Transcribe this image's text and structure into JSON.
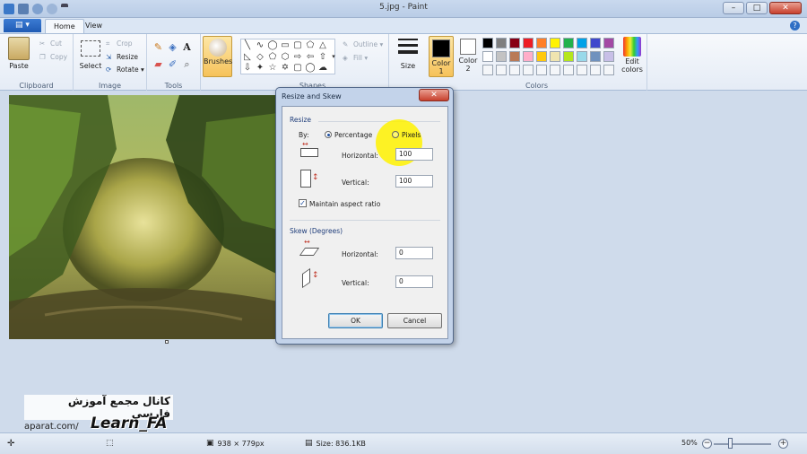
{
  "window": {
    "title": "5.jpg - Paint",
    "controls": {
      "minimize": "–",
      "maximize": "□",
      "close": "✕"
    }
  },
  "tabs": {
    "file": "▤ ▾",
    "home": "Home",
    "view": "View",
    "help": "?"
  },
  "ribbon": {
    "clipboard": {
      "paste": "Paste",
      "cut": "Cut",
      "copy": "Copy",
      "label": "Clipboard"
    },
    "image": {
      "select": "Select",
      "crop": "Crop",
      "resize": "Resize",
      "rotate": "Rotate ▾",
      "label": "Image"
    },
    "tools": {
      "label": "Tools",
      "brushes": "Brushes"
    },
    "shapes": {
      "outline": "Outline ▾",
      "fill": "Fill ▾",
      "label": "Shapes"
    },
    "size": {
      "label": "Size"
    },
    "colors": {
      "color1": "Color 1",
      "color2": "Color 2",
      "edit": "Edit colors",
      "label": "Colors",
      "palette": [
        "#000000",
        "#7f7f7f",
        "#880015",
        "#ed1c24",
        "#ff7f27",
        "#fff200",
        "#22b14c",
        "#00a2e8",
        "#3f48cc",
        "#a349a4",
        "#ffffff",
        "#c3c3c3",
        "#b97a57",
        "#ffaec9",
        "#ffc90e",
        "#efe4b0",
        "#b5e61d",
        "#99d9ea",
        "#7092be",
        "#c8bfe7"
      ]
    }
  },
  "dialog": {
    "title": "Resize and Skew",
    "close": "✕",
    "resize_section": "Resize",
    "by_label": "By:",
    "percentage": "Percentage",
    "pixels": "Pixels",
    "horizontal_label": "Horizontal:",
    "horizontal_value": "100",
    "vertical_label": "Vertical:",
    "vertical_value": "100",
    "maintain_label": "Maintain aspect ratio",
    "maintain_checked": true,
    "skew_section": "Skew (Degrees)",
    "skew_horizontal_label": "Horizontal:",
    "skew_horizontal_value": "0",
    "skew_vertical_label": "Vertical:",
    "skew_vertical_value": "0",
    "ok": "OK",
    "cancel": "Cancel"
  },
  "watermark": {
    "persian": "کانال مجمع آموزش فارسی",
    "site": "aparat.com/",
    "brand": "Learn_FA"
  },
  "status": {
    "dimensions": "938 × 779px",
    "size": "Size: 836.1KB",
    "zoom": "50%",
    "zoom_level": 0.5
  }
}
